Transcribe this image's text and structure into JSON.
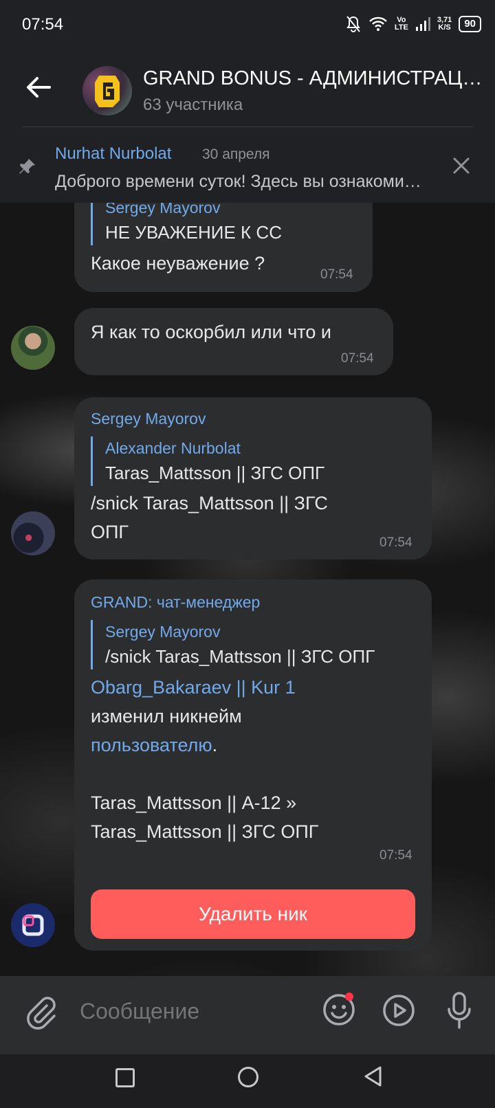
{
  "status_bar": {
    "time": "07:54",
    "icons": [
      "mute-bell-icon",
      "wifi-icon",
      "volte-icon",
      "signal-icon"
    ],
    "volte_top": "Vo",
    "volte_bottom": "LTE",
    "speed_top": "3,71",
    "speed_bottom": "K/S",
    "battery": "90"
  },
  "header": {
    "title": "GRAND BONUS - АДМИНИСТРАЦИЯ",
    "subtitle": "63 участника"
  },
  "pinned": {
    "author": "Nurhat Nurbolat",
    "date": "30 апреля",
    "text": "Доброго времени суток!  Здесь вы ознакомитесь"
  },
  "messages": {
    "m1": {
      "reply_author": "Sergey Mayorov",
      "reply_text": "НЕ УВАЖЕНИЕ К СС",
      "text": "Какое неуважение ?",
      "time": "07:54"
    },
    "m2": {
      "text": "Я как то оскорбил или что и",
      "time": "07:54"
    },
    "m3": {
      "sender": "Sergey Mayorov",
      "reply_author": "Alexander Nurbolat",
      "reply_text": "Taras_Mattsson || ЗГС ОПГ",
      "text_line1": "/snick Taras_Mattsson || ЗГС",
      "text_line2": "ОПГ",
      "time": "07:54"
    },
    "m4": {
      "sender": "GRAND: чат-менеджер",
      "reply_author": "Sergey Mayorov",
      "reply_text": "/snick Taras_Mattsson || ЗГС ОПГ",
      "link_user": "Obarg_Bakaraev || Kur 1",
      "changed": "изменил никнейм",
      "link_target": "пользователю",
      "dot": ".",
      "line_old": "Taras_Mattsson || А-12 »",
      "line_new": "Taras_Mattsson || ЗГС ОПГ",
      "time": "07:54",
      "button": "Удалить ник"
    }
  },
  "input": {
    "placeholder": "Сообщение"
  },
  "colors": {
    "accent": "#71aaeb",
    "bubble": "#2c2d2f",
    "danger": "#ff5c5c",
    "background": "#202124"
  }
}
